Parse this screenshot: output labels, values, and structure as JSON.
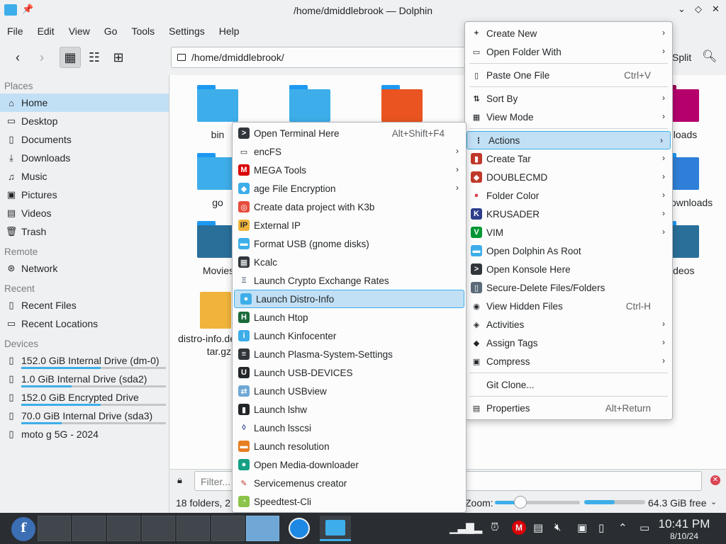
{
  "window": {
    "title": "/home/dmiddlebrook — Dolphin"
  },
  "menubar": [
    "File",
    "Edit",
    "View",
    "Go",
    "Tools",
    "Settings",
    "Help"
  ],
  "toolbar": {
    "location": "/home/dmiddlebrook/",
    "split_label": "Split"
  },
  "sidebar": {
    "places_header": "Places",
    "places": [
      {
        "label": "Home",
        "icon": "home-icon"
      },
      {
        "label": "Desktop",
        "icon": "desktop-icon"
      },
      {
        "label": "Documents",
        "icon": "documents-icon"
      },
      {
        "label": "Downloads",
        "icon": "downloads-icon"
      },
      {
        "label": "Music",
        "icon": "music-icon"
      },
      {
        "label": "Pictures",
        "icon": "pictures-icon"
      },
      {
        "label": "Videos",
        "icon": "videos-icon"
      },
      {
        "label": "Trash",
        "icon": "trash-icon"
      }
    ],
    "remote_header": "Remote",
    "remote": [
      {
        "label": "Network",
        "icon": "network-icon"
      }
    ],
    "recent_header": "Recent",
    "recent": [
      {
        "label": "Recent Files",
        "icon": "recent-files-icon"
      },
      {
        "label": "Recent Locations",
        "icon": "recent-locations-icon"
      }
    ],
    "devices_header": "Devices",
    "devices": [
      {
        "label": "152.0 GiB Internal Drive (dm-0)",
        "usage": 0.55
      },
      {
        "label": "1.0 GiB Internal Drive (sda2)",
        "usage": 0.35
      },
      {
        "label": "152.0 GiB Encrypted Drive",
        "usage": 0.55
      },
      {
        "label": "70.0 GiB Internal Drive (sda3)",
        "usage": 0.28
      },
      {
        "label": "moto g 5G - 2024"
      }
    ]
  },
  "files": {
    "bin": "bin",
    "go": "go",
    "movies": "Movies",
    "downloads_partial": "nloads",
    "downloads_partial2": "ownloads",
    "videos_partial": "ideos",
    "archive_line1": "distro-info.de",
    "archive_line2": "tar.gz"
  },
  "filter": {
    "placeholder": "Filter..."
  },
  "statusbar": {
    "text": "18 folders, 2 f",
    "zoom_label": "Zoom:",
    "zoom_level": 0.3,
    "free_space": "64.3 GiB free",
    "used_fraction": 0.5
  },
  "context_menu": {
    "items": [
      {
        "label": "Create New",
        "icon": "plus-icon",
        "submenu": true
      },
      {
        "label": "Open Folder With",
        "icon": "open-with-icon",
        "submenu": true
      },
      {
        "sep": true
      },
      {
        "label": "Paste One File",
        "icon": "paste-icon",
        "shortcut": "Ctrl+V"
      },
      {
        "sep": true
      },
      {
        "label": "Sort By",
        "icon": "sort-icon",
        "submenu": true
      },
      {
        "label": "View Mode",
        "icon": "view-mode-icon",
        "submenu": true
      },
      {
        "sep": true
      },
      {
        "label": "Actions",
        "icon": "actions-icon",
        "submenu": true,
        "highlighted": true
      },
      {
        "label": "Create Tar",
        "icon": "tar-icon",
        "submenu": true
      },
      {
        "label": "DOUBLECMD",
        "icon": "doublecmd-icon",
        "submenu": true
      },
      {
        "label": "Folder Color",
        "icon": "folder-color-icon",
        "submenu": true
      },
      {
        "label": "KRUSADER",
        "icon": "krusader-icon",
        "submenu": true
      },
      {
        "label": "VIM",
        "icon": "vim-icon",
        "submenu": true
      },
      {
        "label": "Open Dolphin As Root",
        "icon": "dolphin-root-icon"
      },
      {
        "label": "Open Konsole Here",
        "icon": "konsole-icon"
      },
      {
        "label": "Secure-Delete Files/Folders",
        "icon": "secure-delete-icon"
      },
      {
        "label": "View Hidden Files",
        "icon": "eye-icon",
        "shortcut": "Ctrl-H"
      },
      {
        "label": "Activities",
        "icon": "activities-icon",
        "submenu": true
      },
      {
        "label": "Assign Tags",
        "icon": "tag-icon",
        "submenu": true
      },
      {
        "label": "Compress",
        "icon": "compress-icon",
        "submenu": true
      },
      {
        "sep": true
      },
      {
        "label": "Git Clone...",
        "icon": ""
      },
      {
        "sep": true
      },
      {
        "label": "Properties",
        "icon": "properties-icon",
        "shortcut": "Alt+Return"
      }
    ]
  },
  "actions_submenu": {
    "items": [
      {
        "label": "Open Terminal Here",
        "icon": "terminal-icon",
        "shortcut": "Alt+Shift+F4"
      },
      {
        "label": "encFS",
        "icon": "encfs-icon",
        "submenu": true
      },
      {
        "label": "MEGA Tools",
        "icon": "mega-icon",
        "submenu": true
      },
      {
        "label": "age File Encryption",
        "icon": "age-encryption-icon",
        "submenu": true
      },
      {
        "label": "Create data project with K3b",
        "icon": "k3b-icon"
      },
      {
        "label": "External IP",
        "icon": "external-ip-icon"
      },
      {
        "label": "Format USB (gnome disks)",
        "icon": "usb-format-icon"
      },
      {
        "label": "Kcalc",
        "icon": "kcalc-icon"
      },
      {
        "label": "Launch Crypto Exchange Rates",
        "icon": "crypto-icon"
      },
      {
        "label": "Launch Distro-Info",
        "icon": "distro-info-icon",
        "highlighted": true
      },
      {
        "label": "Launch Htop",
        "icon": "htop-icon"
      },
      {
        "label": "Launch Kinfocenter",
        "icon": "kinfocenter-icon"
      },
      {
        "label": "Launch Plasma-System-Settings",
        "icon": "system-settings-icon"
      },
      {
        "label": "Launch USB-DEVICES",
        "icon": "usb-devices-icon"
      },
      {
        "label": "Launch USBview",
        "icon": "usbview-icon"
      },
      {
        "label": "Launch lshw",
        "icon": "lshw-icon"
      },
      {
        "label": "Launch lsscsi",
        "icon": "lsscsi-icon"
      },
      {
        "label": "Launch resolution",
        "icon": "resolution-icon"
      },
      {
        "label": "Open Media-downloader",
        "icon": "media-downloader-icon"
      },
      {
        "label": "Servicemenus creator",
        "icon": "servicemenus-icon"
      },
      {
        "label": "Speedtest-Cli",
        "icon": "speedtest-icon"
      }
    ]
  },
  "taskbar": {
    "time": "10:41 PM",
    "date": "8/10/24",
    "launcher_glyph": "f"
  },
  "colors": {
    "accent": "#3daee9",
    "highlight": "#c2e0f5",
    "folder": "#3daee9"
  }
}
